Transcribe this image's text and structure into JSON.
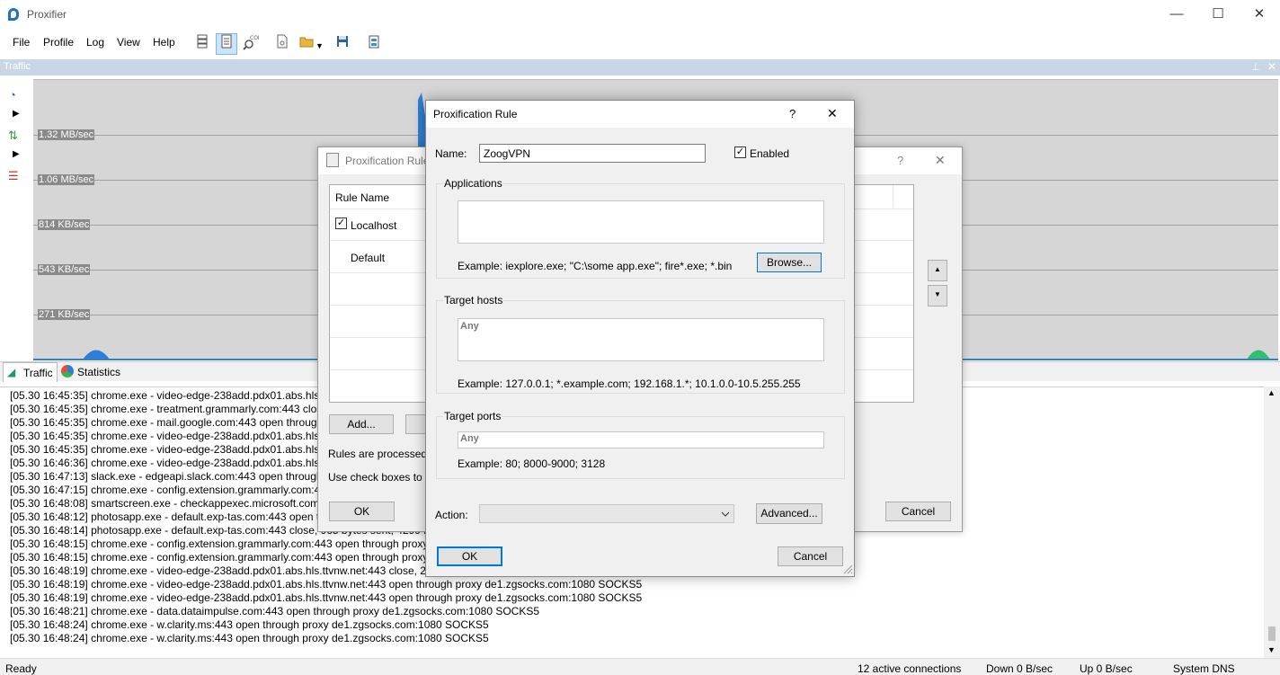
{
  "window": {
    "title": "Proxifier",
    "minimize": "—",
    "maximize": "☐",
    "close": "✕"
  },
  "menu": [
    "File",
    "Profile",
    "Log",
    "View",
    "Help"
  ],
  "traffic": {
    "header": "Traffic",
    "y_labels": [
      "1.32 MB/sec",
      "1.06 MB/sec",
      "814 KB/sec",
      "543 KB/sec",
      "271 KB/sec"
    ],
    "tab_traffic": "Traffic",
    "tab_statistics": "Statistics"
  },
  "log": [
    "[05.30 16:45:35] chrome.exe - video-edge-238add.pdx01.abs.hls.ttvnw.net:443 close",
    "[05.30 16:45:35] chrome.exe - treatment.grammarly.com:443 close",
    "[05.30 16:45:35] chrome.exe - mail.google.com:443 open through proxy",
    "[05.30 16:45:35] chrome.exe - video-edge-238add.pdx01.abs.hls.ttvnw.net:443",
    "[05.30 16:45:35] chrome.exe - video-edge-238add.pdx01.abs.hls.ttvnw.net:443",
    "[05.30 16:46:36] chrome.exe - video-edge-238add.pdx01.abs.hls.ttvnw.net:443",
    "[05.30 16:47:13] slack.exe - edgeapi.slack.com:443 open through proxy",
    "[05.30 16:47:15] chrome.exe - config.extension.grammarly.com:443",
    "[05.30 16:48:08] smartscreen.exe - checkappexec.microsoft.com:443",
    "[05.30 16:48:12] photosapp.exe - default.exp-tas.com:443 open through",
    "[05.30 16:48:14] photosapp.exe - default.exp-tas.com:443 close, 965 bytes sent, 4299 by",
    "[05.30 16:48:15] chrome.exe - config.extension.grammarly.com:443 open through proxy",
    "[05.30 16:48:15] chrome.exe - config.extension.grammarly.com:443 open through proxy",
    "[05.30 16:48:19] chrome.exe - video-edge-238add.pdx01.abs.hls.ttvnw.net:443 close, 204",
    "[05.30 16:48:19] chrome.exe - video-edge-238add.pdx01.abs.hls.ttvnw.net:443 open through proxy de1.zgsocks.com:1080 SOCKS5",
    "[05.30 16:48:19] chrome.exe - video-edge-238add.pdx01.abs.hls.ttvnw.net:443 open through proxy de1.zgsocks.com:1080 SOCKS5",
    "[05.30 16:48:21] chrome.exe - data.dataimpulse.com:443 open through proxy de1.zgsocks.com:1080 SOCKS5",
    "[05.30 16:48:24] chrome.exe - w.clarity.ms:443 open through proxy de1.zgsocks.com:1080 SOCKS5",
    "[05.30 16:48:24] chrome.exe - w.clarity.ms:443 open through proxy de1.zgsocks.com:1080 SOCKS5"
  ],
  "status": {
    "ready": "Ready",
    "connections": "12 active connections",
    "down": "Down 0 B/sec",
    "up": "Up 0 B/sec",
    "dns": "System DNS"
  },
  "rules_dialog": {
    "title": "Proxification Rule",
    "help": "?",
    "close": "✕",
    "col_rule_name": "Rule Name",
    "rules": [
      "Localhost",
      "Default"
    ],
    "add": "Add...",
    "processed_text": "Rules are processed fr",
    "checkbox_text": "Use check boxes to en",
    "ok": "OK",
    "cancel": "Cancel",
    "up": "▲",
    "down": "▼"
  },
  "rule_dialog": {
    "title": "Proxification Rule",
    "help": "?",
    "close": "✕",
    "name_label": "Name:",
    "name_value": "ZoogVPN",
    "enabled_label": "Enabled",
    "applications": {
      "title": "Applications",
      "value": "",
      "example": "Example: iexplore.exe; \"C:\\some app.exe\"; fire*.exe; *.bin",
      "browse": "Browse..."
    },
    "target_hosts": {
      "title": "Target hosts",
      "value": "Any",
      "example": "Example: 127.0.0.1; *.example.com; 192.168.1.*; 10.1.0.0-10.5.255.255"
    },
    "target_ports": {
      "title": "Target ports",
      "value": "Any",
      "example": "Example: 80; 8000-9000; 3128"
    },
    "action_label": "Action:",
    "action_value": "",
    "advanced": "Advanced...",
    "ok": "OK",
    "cancel": "Cancel"
  }
}
